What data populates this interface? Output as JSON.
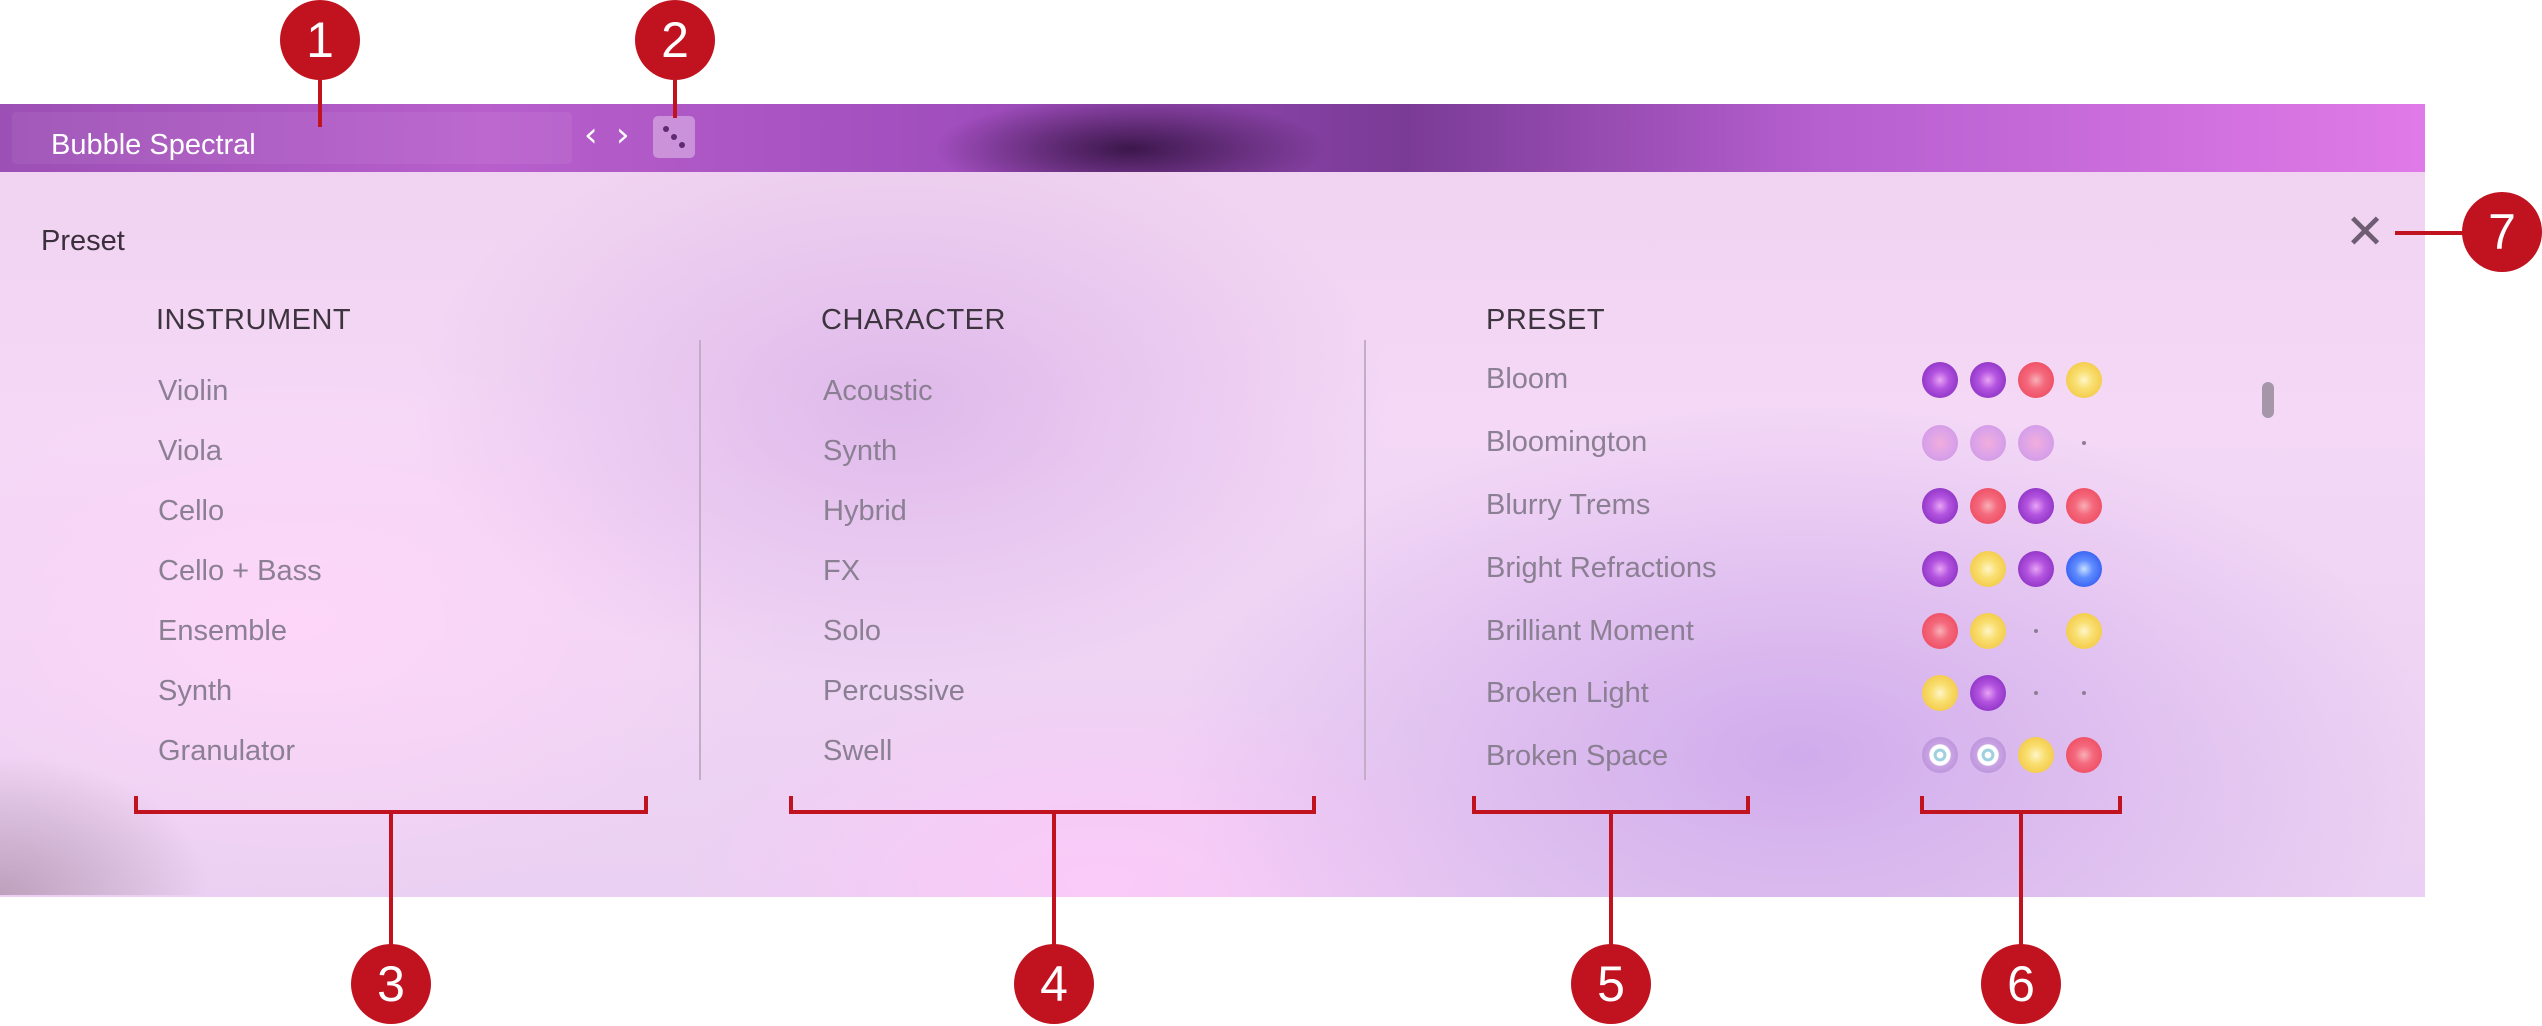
{
  "header": {
    "title": "Bubble Spectral",
    "prev_icon": "‹",
    "next_icon": "›",
    "dice_icon": "dice-icon"
  },
  "panel": {
    "label": "Preset",
    "close_icon": "✕"
  },
  "columns": {
    "instrument": {
      "heading": "INSTRUMENT",
      "items": [
        "Violin",
        "Viola",
        "Cello",
        "Cello + Bass",
        "Ensemble",
        "Synth",
        "Granulator"
      ]
    },
    "character": {
      "heading": "CHARACTER",
      "items": [
        "Acoustic",
        "Synth",
        "Hybrid",
        "FX",
        "Solo",
        "Percussive",
        "Swell"
      ]
    },
    "preset": {
      "heading": "PRESET",
      "items": [
        {
          "name": "Bloom",
          "dots": [
            "purple",
            "purple",
            "red",
            "yellow"
          ]
        },
        {
          "name": "Bloomington",
          "dots": [
            "faded",
            "faded",
            "faded",
            "empty"
          ]
        },
        {
          "name": "Blurry Trems",
          "dots": [
            "purple",
            "red",
            "purple",
            "red"
          ]
        },
        {
          "name": "Bright Refractions",
          "dots": [
            "purple",
            "yellow",
            "purple",
            "blue"
          ]
        },
        {
          "name": "Brilliant Moment",
          "dots": [
            "red",
            "yellow",
            "empty",
            "yellow"
          ]
        },
        {
          "name": "Broken Light",
          "dots": [
            "yellow",
            "purple",
            "empty",
            "empty"
          ]
        },
        {
          "name": "Broken Space",
          "dots": [
            "ring",
            "ring",
            "yellow",
            "red"
          ]
        }
      ]
    }
  },
  "callouts": [
    "1",
    "2",
    "3",
    "4",
    "5",
    "6",
    "7"
  ],
  "colors": {
    "callout": "#c1121f",
    "header_start": "#9c4fb5",
    "header_end": "#e07ae8"
  }
}
